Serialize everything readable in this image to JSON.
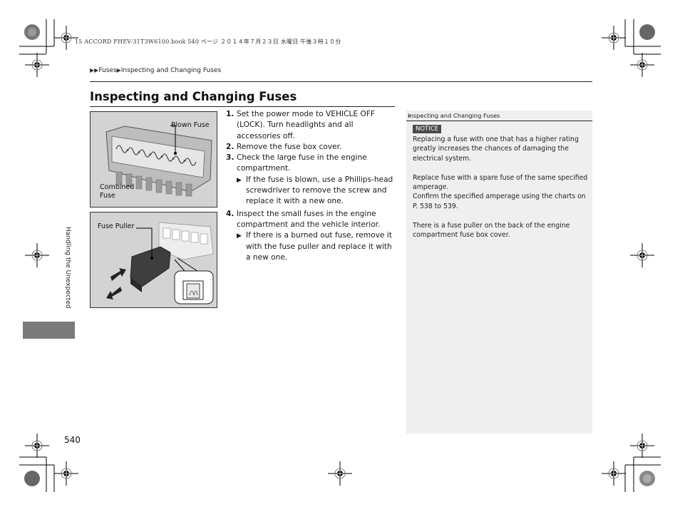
{
  "print_header": "15 ACCORD FHEV-31T3W6100.book  540 ページ  ２０１４年７月２３日  水曜日  午後３時１０分",
  "breadcrumb": {
    "items": [
      "Fuses",
      "Inspecting and Changing Fuses"
    ],
    "separator_icon": "triangle-right-icon"
  },
  "page_title": "Inspecting and Changing Fuses",
  "figures": [
    {
      "name": "combined-fuse-illustration",
      "labels": {
        "blown": "Blown Fuse",
        "combined_line1": "Combined",
        "combined_line2": "Fuse"
      }
    },
    {
      "name": "fuse-puller-illustration",
      "labels": {
        "puller": "Fuse Puller"
      }
    }
  ],
  "steps": [
    {
      "num": "1.",
      "text": "Set the power mode to VEHICLE OFF (LOCK). Turn headlights and all accessories off."
    },
    {
      "num": "2.",
      "text": "Remove the fuse box cover."
    },
    {
      "num": "3.",
      "text": "Check the large fuse in the engine compartment.",
      "sub": "If the fuse is blown, use a Phillips-head screwdriver to remove the screw and replace it with a new one."
    },
    {
      "num": "4.",
      "text": "Inspect the small fuses in the engine compartment and the vehicle interior.",
      "sub": "If there is a burned out fuse, remove it with the fuse puller and replace it with a new one."
    }
  ],
  "sidebar": {
    "header_icon": "double-chevron-right-icon",
    "header": "Inspecting and Changing Fuses",
    "notice_label": "NOTICE",
    "notice_text": "Replacing a fuse with one that has a higher rating greatly increases the chances of damaging the electrical system.",
    "paragraph_1a": "Replace fuse with a spare fuse of the same specified amperage.",
    "paragraph_1b": "Confirm the specified amperage using the charts on P. 538 to 539.",
    "paragraph_2": "There is a fuse puller on the back of the engine compartment fuse box cover."
  },
  "section_tab": "Handling the Unexpected",
  "page_number": "540",
  "glyphs": {
    "triangle": "▶",
    "double_chevron": "»"
  }
}
